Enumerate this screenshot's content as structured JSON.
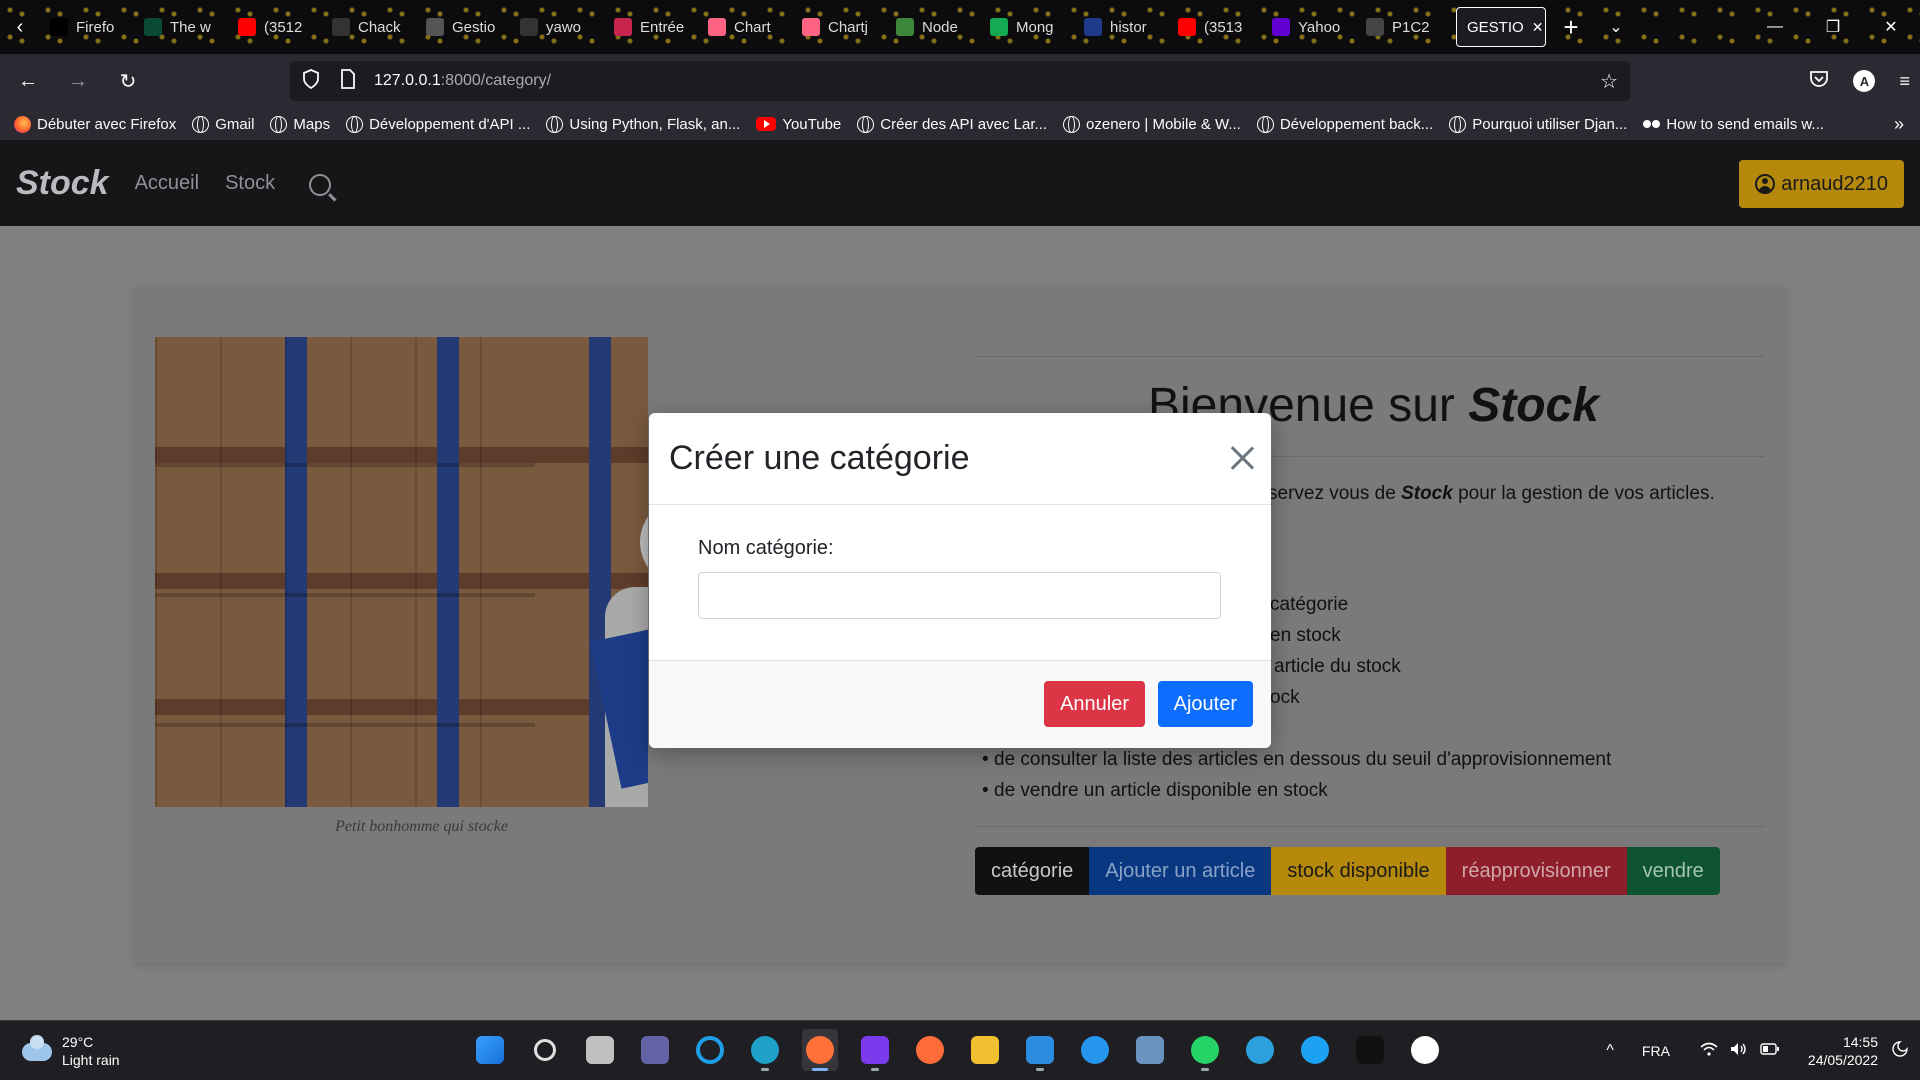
{
  "browser": {
    "tabs": [
      {
        "label": "Firefo",
        "icon": "medium-icon",
        "color": "#000000"
      },
      {
        "label": "The w",
        "icon": "django-icon",
        "color": "#0c4b33"
      },
      {
        "label": "(3512",
        "icon": "youtube-icon",
        "color": "#ff0000"
      },
      {
        "label": "Chack",
        "icon": "github-icon",
        "color": "#333333"
      },
      {
        "label": "Gestio",
        "icon": "puzzle-icon",
        "color": "#555555"
      },
      {
        "label": "yawo",
        "icon": "github-icon",
        "color": "#333333"
      },
      {
        "label": "Entrée",
        "icon": "figure-icon",
        "color": "#c7254e"
      },
      {
        "label": "Chart",
        "icon": "chartjs-icon",
        "color": "#ff6384"
      },
      {
        "label": "Chartj",
        "icon": "chartjs-icon",
        "color": "#ff6384"
      },
      {
        "label": "Node",
        "icon": "node-icon",
        "color": "#3c873a"
      },
      {
        "label": "Mong",
        "icon": "mongodb-icon",
        "color": "#13aa52"
      },
      {
        "label": "histor",
        "icon": "db-icon",
        "color": "#1e3a8a"
      },
      {
        "label": "(3513",
        "icon": "youtube-icon",
        "color": "#ff0000"
      },
      {
        "label": "Yahoo",
        "icon": "yahoo-icon",
        "color": "#6001d2"
      },
      {
        "label": "P1C2",
        "icon": "openclassrooms-icon",
        "color": "#444444"
      }
    ],
    "active_tab": {
      "label": "GESTIO",
      "close": "✕"
    },
    "new_tab": "+",
    "tab_list": "⌄",
    "window_controls": {
      "minimize": "—",
      "restore": "❐",
      "close": "✕"
    },
    "nav": {
      "back": "←",
      "forward": "→",
      "reload": "↻"
    },
    "url": {
      "host": "127.0.0.1",
      "rest": ":8000/category/"
    },
    "bookmark_star": "☆",
    "account_letter": "A",
    "menu": "≡",
    "bookmarks": [
      {
        "label": "Débuter avec Firefox",
        "icon": "firefox"
      },
      {
        "label": "Gmail",
        "icon": "globe"
      },
      {
        "label": "Maps",
        "icon": "globe"
      },
      {
        "label": "Développement d'API ...",
        "icon": "globe"
      },
      {
        "label": "Using Python, Flask, an...",
        "icon": "globe"
      },
      {
        "label": "YouTube",
        "icon": "youtube"
      },
      {
        "label": "Créer des API avec Lar...",
        "icon": "globe"
      },
      {
        "label": "ozenero | Mobile & W...",
        "icon": "globe"
      },
      {
        "label": "Développement back...",
        "icon": "globe"
      },
      {
        "label": "Pourquoi utiliser Djan...",
        "icon": "globe"
      },
      {
        "label": "How to send emails w...",
        "icon": "dots"
      }
    ],
    "bookmarks_more": "»"
  },
  "site": {
    "brand": "Stock",
    "links": [
      "Accueil",
      "Stock"
    ],
    "user": "arnaud2210",
    "image_caption": "Petit bonhomme qui stocke",
    "welcome_prefix": "Bienvenue sur ",
    "welcome_brand": "Stock",
    "intro_pre": "servez vous de ",
    "intro_brand": "Stock",
    "intro_post": " pour la gestion de vos articles.",
    "feature_fragments": [
      "catégorie",
      "en stock",
      "article du stock",
      "ock"
    ],
    "features_full": [
      "de consulter la liste des articles en dessous du seuil d'approvisionnement",
      "de vendre un article disponible en stock"
    ],
    "buttons": [
      "catégorie",
      "Ajouter un article",
      "stock disponible",
      "réapprovisionner",
      "vendre"
    ]
  },
  "modal": {
    "title": "Créer une catégorie",
    "label": "Nom catégorie:",
    "input_value": "",
    "cancel": "Annuler",
    "submit": "Ajouter"
  },
  "taskbar": {
    "temperature": "29°C",
    "weather": "Light rain",
    "apps": [
      {
        "name": "start",
        "color": "#1e90ff"
      },
      {
        "name": "search",
        "color": "#e0e0e0"
      },
      {
        "name": "task-view",
        "color": "#c0c0c0"
      },
      {
        "name": "teams",
        "color": "#6264a7"
      },
      {
        "name": "cortana",
        "color": "#1ea0e8"
      },
      {
        "name": "edge",
        "color": "#1fa0c8"
      },
      {
        "name": "firefox",
        "color": "#ff7139"
      },
      {
        "name": "discord-like",
        "color": "#7c3aed"
      },
      {
        "name": "postman",
        "color": "#ff6c37"
      },
      {
        "name": "file-explorer",
        "color": "#f0c030"
      },
      {
        "name": "vscode",
        "color": "#2a8ce0"
      },
      {
        "name": "docker",
        "color": "#2496ed"
      },
      {
        "name": "postgresql",
        "color": "#6a93c0"
      },
      {
        "name": "whatsapp",
        "color": "#25d366"
      },
      {
        "name": "telegram",
        "color": "#2aa0dc"
      },
      {
        "name": "twitter",
        "color": "#1da1f2"
      },
      {
        "name": "netflix",
        "color": "#111111"
      },
      {
        "name": "wordpad",
        "color": "#ffffff"
      }
    ],
    "active_app": "firefox",
    "tray_chevron": "^",
    "language": "FRA",
    "time": "14:55",
    "date": "24/05/2022"
  }
}
